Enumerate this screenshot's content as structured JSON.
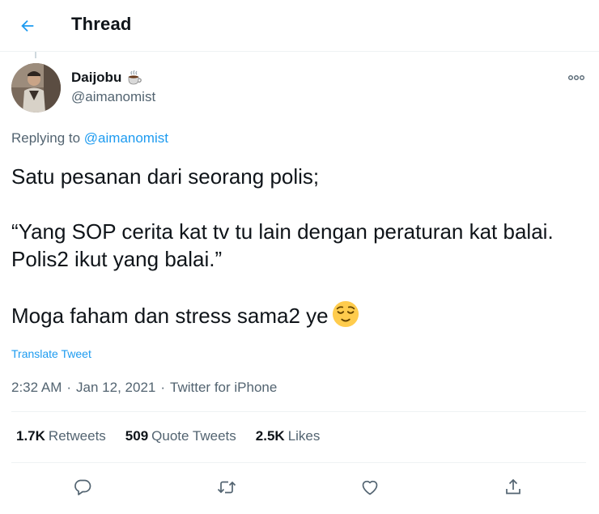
{
  "header": {
    "title": "Thread",
    "back_icon": "arrow-left-icon"
  },
  "tweet": {
    "author": {
      "display_name": "Daijobu",
      "name_emoji": "hot-beverage-icon",
      "handle": "@aimanomist"
    },
    "replying_to_label": "Replying to",
    "replying_to_handle": "@aimanomist",
    "text": {
      "line1": "Satu pesanan dari seorang polis;",
      "line2": "“Yang SOP cerita kat tv tu lain dengan peraturan kat balai. Polis2 ikut yang balai.”",
      "line3": "Moga faham dan stress sama2 ye",
      "emoji": "relieved-face-icon"
    },
    "translate_label": "Translate Tweet",
    "time": "2:32 AM",
    "separator": "·",
    "date": "Jan 12, 2021",
    "source": "Twitter for iPhone"
  },
  "stats": {
    "retweets_count": "1.7K",
    "retweets_label": "Retweets",
    "quotes_count": "509",
    "quotes_label": "Quote Tweets",
    "likes_count": "2.5K",
    "likes_label": "Likes"
  },
  "actions": {
    "reply_icon": "reply-icon",
    "retweet_icon": "retweet-icon",
    "like_icon": "heart-icon",
    "share_icon": "share-icon",
    "more_icon": "more-icon"
  },
  "colors": {
    "accent": "#1d9bf0",
    "text": "#0f1419",
    "secondary": "#536471",
    "border": "#eff3f4"
  }
}
